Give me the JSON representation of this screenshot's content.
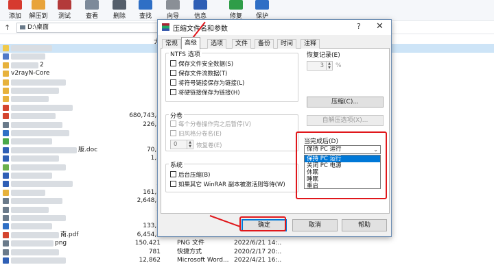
{
  "toolbar": {
    "items": [
      {
        "label": "添加",
        "icon": "add-icon",
        "color": "#d63a2f"
      },
      {
        "label": "解压到",
        "icon": "extract-to-icon",
        "color": "#e8a33a"
      },
      {
        "label": "测试",
        "icon": "test-icon",
        "color": "#b33a3a"
      },
      {
        "label": "查看",
        "icon": "view-icon",
        "color": "#7d8a9a"
      },
      {
        "label": "删除",
        "icon": "delete-icon",
        "color": "#555f6b"
      },
      {
        "label": "查找",
        "icon": "find-icon",
        "color": "#2f6fc5"
      },
      {
        "label": "向导",
        "icon": "wizard-icon",
        "color": "#8a8f96"
      },
      {
        "label": "信息",
        "icon": "info-icon",
        "color": "#2f5fb5"
      },
      {
        "label": "修复",
        "icon": "repair-icon",
        "color": "#2f9d48"
      },
      {
        "label": "保护",
        "icon": "protect-icon",
        "color": "#2f6fc5"
      }
    ]
  },
  "address": {
    "path": "D:\\桌面",
    "up_glyph": "↑"
  },
  "filelist": {
    "size_header": "大",
    "rows": [
      {
        "name": "",
        "size": "",
        "type": "",
        "date": "",
        "blur": 60,
        "color": "#f0c94a",
        "selected": true
      },
      {
        "name": "",
        "size": "",
        "type": "",
        "date": "",
        "blur": 50,
        "color": "#4f79c8"
      },
      {
        "name": "2",
        "size": "",
        "type": "",
        "date": "",
        "blur": 40,
        "color": "#e7b23c"
      },
      {
        "name": "v2rayN-Core",
        "size": "",
        "type": "",
        "date": "",
        "blur": 0,
        "color": "#e7b23c"
      },
      {
        "name": "",
        "size": "",
        "type": "",
        "date": "",
        "blur": 80,
        "color": "#e7b23c"
      },
      {
        "name": "",
        "size": "",
        "type": "",
        "date": "",
        "blur": 70,
        "color": "#e7b23c"
      },
      {
        "name": "",
        "size": "",
        "type": "",
        "date": "",
        "blur": 55,
        "color": "#e7b23c"
      },
      {
        "name": "",
        "size": "",
        "type": "",
        "date": "",
        "blur": 90,
        "color": "#d4452f"
      },
      {
        "name": "",
        "size": "680,743,4",
        "type": "",
        "date": "",
        "blur": 65,
        "color": "#d4452f"
      },
      {
        "name": "",
        "size": "226,7",
        "type": "",
        "date": "",
        "blur": 75,
        "color": "#6a7a8a"
      },
      {
        "name": "",
        "size": "",
        "type": "",
        "date": "",
        "blur": 85,
        "color": "#2f6fc5"
      },
      {
        "name": "",
        "size": "",
        "type": "",
        "date": "",
        "blur": 60,
        "color": "#4aa84a"
      },
      {
        "name": "版.doc",
        "size": "70,6",
        "type": "",
        "date": "",
        "blur": 96,
        "color": "#2f5fb5"
      },
      {
        "name": "",
        "size": "1,8",
        "type": "",
        "date": "",
        "blur": 70,
        "color": "#2f5fb5"
      },
      {
        "name": "",
        "size": "3",
        "type": "",
        "date": "",
        "blur": 80,
        "color": "#6ab04c"
      },
      {
        "name": "",
        "size": "",
        "type": "",
        "date": "",
        "blur": 60,
        "color": "#2f5fb5"
      },
      {
        "name": "",
        "size": "2",
        "type": "",
        "date": "",
        "blur": 90,
        "color": "#2f5fb5"
      },
      {
        "name": "",
        "size": "161,8",
        "type": "",
        "date": "",
        "blur": 50,
        "color": "#e7b23c"
      },
      {
        "name": "",
        "size": "2,648,6",
        "type": "",
        "date": "",
        "blur": 75,
        "color": "#6a7a8a"
      },
      {
        "name": "",
        "size": "2",
        "type": "",
        "date": "",
        "blur": 55,
        "color": "#6a7a8a"
      },
      {
        "name": "",
        "size": "7",
        "type": "",
        "date": "",
        "blur": 80,
        "color": "#6a7a8a"
      },
      {
        "name": "",
        "size": "133,7",
        "type": "",
        "date": "",
        "blur": 60,
        "color": "#2f6fc5"
      },
      {
        "name": "南.pdf",
        "size": "6,454,4",
        "type": "",
        "date": "",
        "blur": 70,
        "color": "#d4452f"
      },
      {
        "name": "png",
        "size": "150,421",
        "type": "PNG 文件",
        "date": "2022/6/21 14:..",
        "blur": 62,
        "color": "#6a7a8a"
      },
      {
        "name": "",
        "size": "781",
        "type": "快捷方式",
        "date": "2020/2/17 20:..",
        "blur": 70,
        "color": "#6a7a8a"
      },
      {
        "name": "",
        "size": "12,862",
        "type": "Microsoft Word...",
        "date": "2022/4/21 16:..",
        "blur": 80,
        "color": "#2f5fb5"
      }
    ]
  },
  "dialog": {
    "title": "压缩文件名和参数",
    "help": "?",
    "close": "✕",
    "tabs": [
      {
        "label": "常规",
        "active": false
      },
      {
        "label": "高级",
        "active": true
      },
      {
        "label": "选项",
        "active": false
      },
      {
        "label": "文件",
        "active": false
      },
      {
        "label": "备份",
        "active": false
      },
      {
        "label": "时间",
        "active": false
      },
      {
        "label": "注释",
        "active": false
      }
    ],
    "ntfs": {
      "title": "NTFS 选项",
      "options": [
        "保存文件安全数据(S)",
        "保存文件流数据(T)",
        "将符号链接保存为链接(L)",
        "将硬链接保存为链接(H)"
      ]
    },
    "recovery": {
      "title": "恢复记录(E)",
      "value": "3",
      "unit": "%"
    },
    "compress_button": "压缩(C)...",
    "sfx_button": "自解压选项(X)...",
    "volumes": {
      "title": "分卷",
      "options": [
        "每个分卷操作完之后暂停(V)",
        "旧风格分卷名(E)"
      ],
      "spin_value": "0",
      "spin_label": "恢复卷(E)"
    },
    "system": {
      "title": "系统",
      "options": [
        "后台压缩(B)",
        "如果其它 WinRAR 副本被激活则等待(W)"
      ]
    },
    "after": {
      "label": "当完成后(D)",
      "selected": "保持 PC 运行",
      "options": [
        "保持 PC 运行",
        "关闭 PC 电源",
        "休眠",
        "睡眠",
        "重启"
      ]
    },
    "buttons": {
      "ok": "确定",
      "cancel": "取消",
      "help": "帮助"
    }
  },
  "accent_colors": {
    "annotation_red": "#e0171b",
    "selection_blue": "#0078d7"
  }
}
